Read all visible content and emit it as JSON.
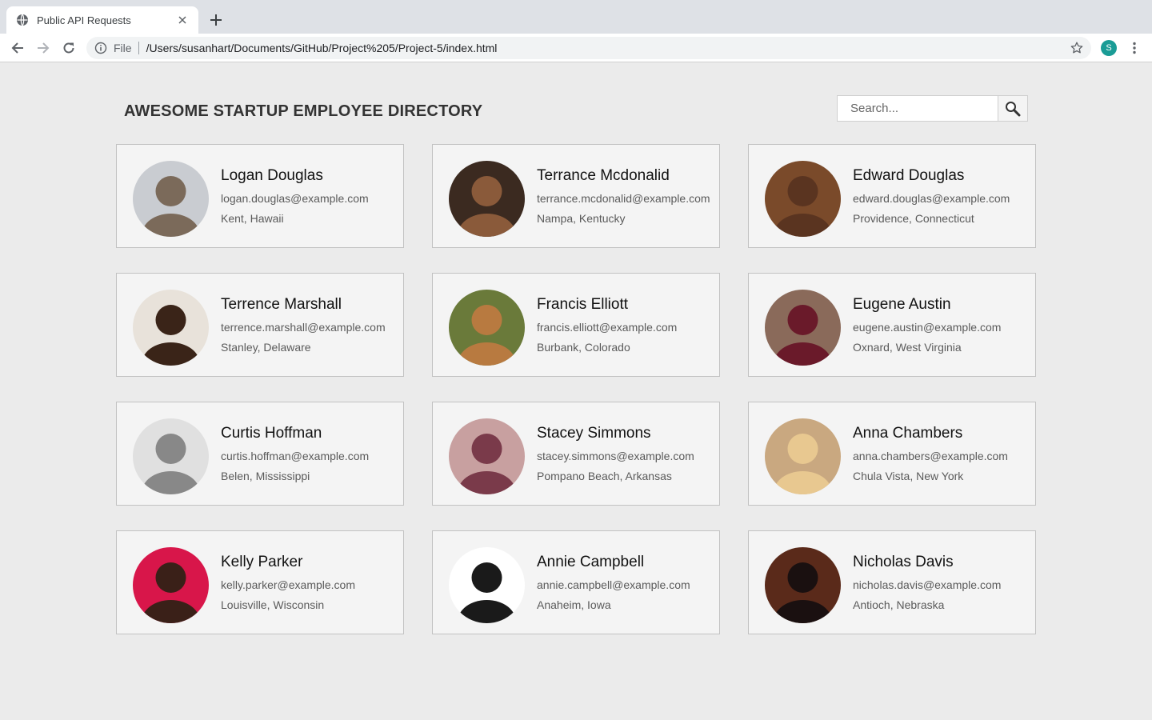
{
  "browser": {
    "tab_title": "Public API Requests",
    "scheme_label": "File",
    "url": "/Users/susanhart/Documents/GitHub/Project%205/Project-5/index.html",
    "profile_initial": "S",
    "profile_color": "#1a9c96"
  },
  "page": {
    "title": "AWESOME STARTUP EMPLOYEE DIRECTORY",
    "search_placeholder": "Search..."
  },
  "employees": [
    {
      "name": "Logan Douglas",
      "email": "logan.douglas@example.com",
      "location": "Kent, Hawaii"
    },
    {
      "name": "Terrance Mcdonalid",
      "email": "terrance.mcdonalid@example.com",
      "location": "Nampa, Kentucky"
    },
    {
      "name": "Edward Douglas",
      "email": "edward.douglas@example.com",
      "location": "Providence, Connecticut"
    },
    {
      "name": "Terrence Marshall",
      "email": "terrence.marshall@example.com",
      "location": "Stanley, Delaware"
    },
    {
      "name": "Francis Elliott",
      "email": "francis.elliott@example.com",
      "location": "Burbank, Colorado"
    },
    {
      "name": "Eugene Austin",
      "email": "eugene.austin@example.com",
      "location": "Oxnard, West Virginia"
    },
    {
      "name": "Curtis Hoffman",
      "email": "curtis.hoffman@example.com",
      "location": "Belen, Mississippi"
    },
    {
      "name": "Stacey Simmons",
      "email": "stacey.simmons@example.com",
      "location": "Pompano Beach, Arkansas"
    },
    {
      "name": "Anna Chambers",
      "email": "anna.chambers@example.com",
      "location": "Chula Vista, New York"
    },
    {
      "name": "Kelly Parker",
      "email": "kelly.parker@example.com",
      "location": "Louisville, Wisconsin"
    },
    {
      "name": "Annie Campbell",
      "email": "annie.campbell@example.com",
      "location": "Anaheim, Iowa"
    },
    {
      "name": "Nicholas Davis",
      "email": "nicholas.davis@example.com",
      "location": "Antioch, Nebraska"
    }
  ]
}
